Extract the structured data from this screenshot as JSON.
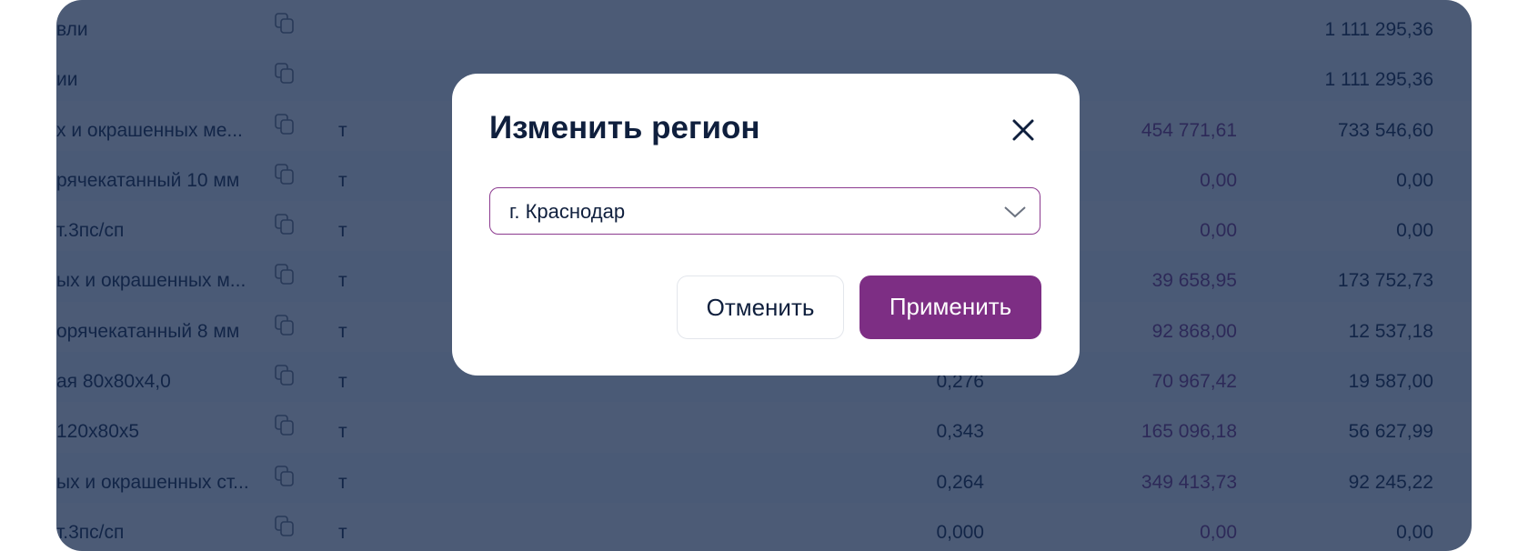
{
  "table": {
    "rows": [
      {
        "name": "вли",
        "unit": "",
        "qty": "",
        "price": "",
        "total": "1 111 295,36"
      },
      {
        "name": "ии",
        "unit": "",
        "qty": "",
        "price": "",
        "total": "1 111 295,36"
      },
      {
        "name": "х и окрашенных ме...",
        "unit": "т",
        "qty": "",
        "price": "454 771,61",
        "total": "733 546,60"
      },
      {
        "name": "рячекатанный 10 мм",
        "unit": "т",
        "qty": "",
        "price": "0,00",
        "total": "0,00"
      },
      {
        "name": "т.3пс/сп",
        "unit": "т",
        "qty": "",
        "price": "0,00",
        "total": "0,00"
      },
      {
        "name": "ых и окрашенных м...",
        "unit": "т",
        "qty": "",
        "price": "39 658,95",
        "total": "173 752,73"
      },
      {
        "name": "орячекатанный 8 мм",
        "unit": "т",
        "qty": "",
        "price": "92 868,00",
        "total": "12 537,18"
      },
      {
        "name": "ая 80х80х4,0",
        "unit": "т",
        "qty": "0,276",
        "price": "70 967,42",
        "total": "19 587,00"
      },
      {
        "name": " 120х80х5",
        "unit": "т",
        "qty": "0,343",
        "price": "165 096,18",
        "total": "56 627,99"
      },
      {
        "name": "ых и окрашенных ст...",
        "unit": "т",
        "qty": "0,264",
        "price": "349 413,73",
        "total": "92 245,22"
      },
      {
        "name": "т.3пс/сп",
        "unit": "т",
        "qty": "0,000",
        "price": "0,00",
        "total": "0,00"
      }
    ]
  },
  "modal": {
    "title": "Изменить регион",
    "region_value": "г. Краснодар",
    "cancel_label": "Отменить",
    "apply_label": "Применить"
  },
  "colors": {
    "accent": "#7d2e84",
    "overlay": "#14284b",
    "text": "#0f1f3d"
  },
  "icons": {
    "copy": "copy-icon",
    "close": "close-icon",
    "dropdown": "chevron-down-icon"
  }
}
